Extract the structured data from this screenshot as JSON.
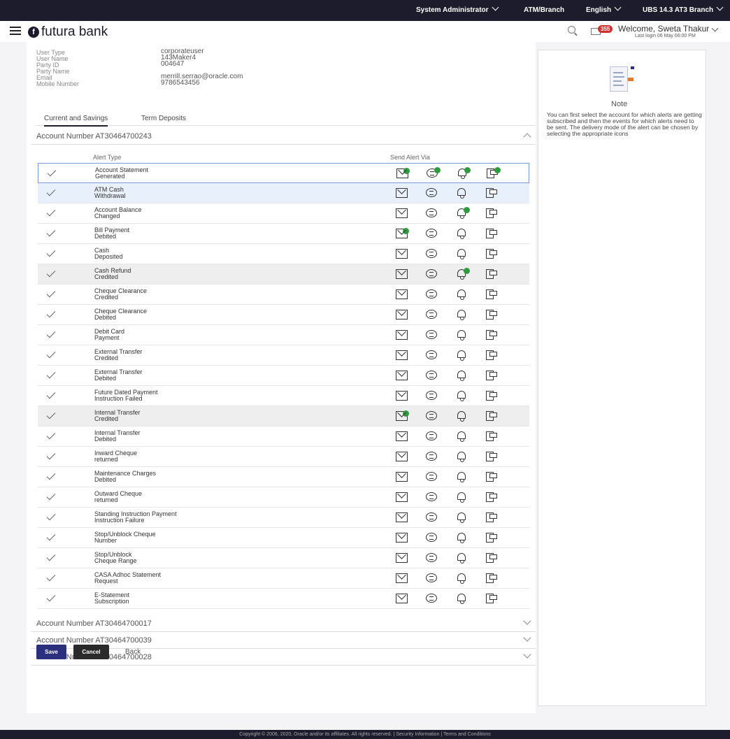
{
  "topbar": {
    "role": "System Administrator",
    "entity": "ATM/Branch",
    "language": "English",
    "branch": "UBS 14.3 AT3 Branch"
  },
  "header": {
    "logo_text": "futura bank",
    "logo_letter": "f",
    "notification_count": "355",
    "welcome": "Welcome, Sweta Thakur",
    "last_login": "Last login 06 May 06:00 PM"
  },
  "user_info": [
    {
      "label": "User Type",
      "value": "corporateuser"
    },
    {
      "label": "User Name",
      "value": "143Maker4"
    },
    {
      "label": "Party ID",
      "value": "004647"
    },
    {
      "label": "Party Name",
      "value": ""
    },
    {
      "label": "Email",
      "value": "merrill.serrao@oracle.com"
    },
    {
      "label": "Mobile Number",
      "value": "9786543456"
    }
  ],
  "tabs": [
    {
      "label": "Current and Savings",
      "active": true
    },
    {
      "label": "Term Deposits",
      "active": false
    }
  ],
  "expanded_account": "Account Number AT30464700243",
  "columns": {
    "alert_type": "Alert Type",
    "send_via": "Send Alert Via"
  },
  "alerts": [
    {
      "line1": "Account Statement",
      "line2": "Generated",
      "email": true,
      "sms": true,
      "bell": true,
      "push": true
    },
    {
      "line1": "ATM Cash",
      "line2": "Withdrawal",
      "email": false,
      "sms": false,
      "bell": false,
      "push": false
    },
    {
      "line1": "Account Balance",
      "line2": "Changed",
      "email": false,
      "sms": false,
      "bell": true,
      "push": false
    },
    {
      "line1": "Bill Payment",
      "line2": "Debited",
      "email": true,
      "sms": false,
      "bell": false,
      "push": false
    },
    {
      "line1": "Cash",
      "line2": "Deposited",
      "email": false,
      "sms": false,
      "bell": false,
      "push": false
    },
    {
      "line1": "Cash Refund",
      "line2": "Credited",
      "email": false,
      "sms": false,
      "bell": true,
      "push": false
    },
    {
      "line1": "Cheque Clearance",
      "line2": "Credited",
      "email": false,
      "sms": false,
      "bell": false,
      "push": false
    },
    {
      "line1": "Cheque Clearance",
      "line2": "Debited",
      "email": false,
      "sms": false,
      "bell": false,
      "push": false
    },
    {
      "line1": "Debit Card",
      "line2": "Payment",
      "email": false,
      "sms": false,
      "bell": false,
      "push": false
    },
    {
      "line1": "External Transfer",
      "line2": "Credited",
      "email": false,
      "sms": false,
      "bell": false,
      "push": false
    },
    {
      "line1": "External Transfer",
      "line2": "Debited",
      "email": false,
      "sms": false,
      "bell": false,
      "push": false
    },
    {
      "line1": "Future Dated Payment",
      "line2": "Instruction Failed",
      "email": false,
      "sms": false,
      "bell": false,
      "push": false
    },
    {
      "line1": "Internal Transfer",
      "line2": "Credited",
      "email": true,
      "sms": false,
      "bell": false,
      "push": false
    },
    {
      "line1": "Internal Transfer",
      "line2": "Debited",
      "email": false,
      "sms": false,
      "bell": false,
      "push": false
    },
    {
      "line1": "Inward Cheque",
      "line2": "returned",
      "email": false,
      "sms": false,
      "bell": false,
      "push": false
    },
    {
      "line1": "Maintenance Charges",
      "line2": "Debited",
      "email": false,
      "sms": false,
      "bell": false,
      "push": false
    },
    {
      "line1": "Outward Cheque",
      "line2": "returned",
      "email": false,
      "sms": false,
      "bell": false,
      "push": false
    },
    {
      "line1": "Standing Instruction Payment",
      "line2": "Instruction Failure",
      "email": false,
      "sms": false,
      "bell": false,
      "push": false
    },
    {
      "line1": "Stop/Unblock Cheque",
      "line2": "Number",
      "email": false,
      "sms": false,
      "bell": false,
      "push": false
    },
    {
      "line1": "Stop/Unblock",
      "line2": "Cheque Range",
      "email": false,
      "sms": false,
      "bell": false,
      "push": false
    },
    {
      "line1": "CASA Adhoc Statement",
      "line2": "Request",
      "email": false,
      "sms": false,
      "bell": false,
      "push": false
    },
    {
      "line1": "E-Statement",
      "line2": "Subscription",
      "email": false,
      "sms": false,
      "bell": false,
      "push": false
    }
  ],
  "collapsed_accounts": [
    "Account Number AT30464700017",
    "Account Number AT30464700039",
    "Account Number AT30464700028"
  ],
  "buttons": {
    "save": "Save",
    "cancel": "Cancel",
    "back": "Back"
  },
  "note": {
    "title": "Note",
    "text": "You can first select the account for which alerts are getting subscribed and then the events for which alerts need to be sent. The delivery mode of the alert can be chosen by selecting the appropriate icons"
  },
  "footer": "Copyright © 2006, 2020, Oracle and/or its affiliates. All rights reserved. | Security Information | Terms and Conditions",
  "colors": {
    "brand": "#1c1c2c",
    "primary_button": "#2a2f7e",
    "subscribed_dot": "#2e9c3e",
    "badge": "#d32f2f"
  }
}
